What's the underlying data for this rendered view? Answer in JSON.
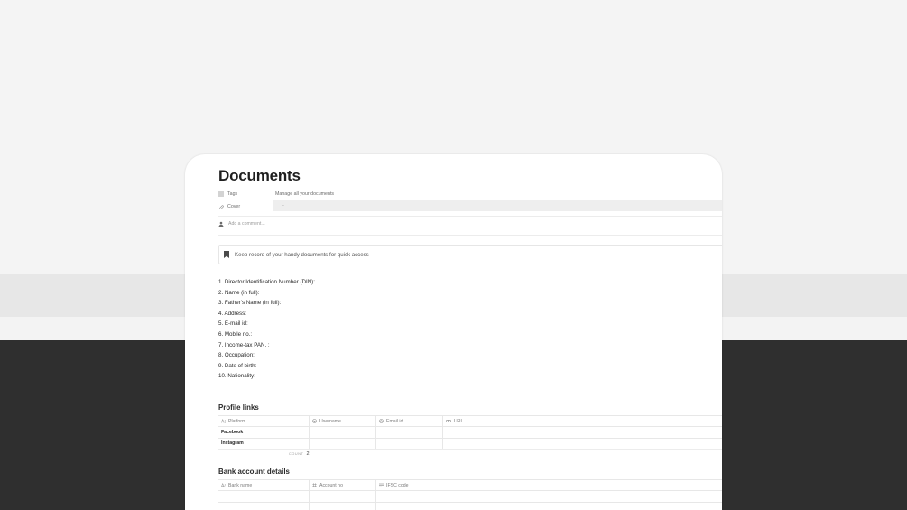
{
  "page": {
    "title": "Documents",
    "properties": [
      {
        "icon": "list-icon",
        "name": "Tags",
        "value": "Manage all your documents"
      },
      {
        "icon": "paperclip-icon",
        "name": "Cover",
        "value": "-"
      }
    ],
    "comment_placeholder": "Add a comment...",
    "callout": "Keep record of your handy documents for quick access"
  },
  "details_list": [
    "1. Director Identification Number (DIN):",
    "2. Name (in full):",
    "3. Father's Name (in full):",
    "4. Address:",
    "5. E-mail id:",
    "6. Mobile no.:",
    "7. Income-tax PAN. :",
    "8. Occupation:",
    "9. Date of birth:",
    "10. Nationality:"
  ],
  "profile_links": {
    "heading": "Profile links",
    "columns": [
      "Platform",
      "Username",
      "Email id",
      "URL"
    ],
    "rows": [
      [
        "Facebook",
        "",
        "",
        ""
      ],
      [
        "Instagram",
        "",
        "",
        ""
      ]
    ],
    "count_label": "COUNT",
    "count_value": "2"
  },
  "bank_details": {
    "heading": "Bank account details",
    "columns": [
      "Bank name",
      "Account no",
      "IFSC code"
    ]
  },
  "colors": {
    "background": "#f4f4f4",
    "band": "#e7e7e7",
    "dark_footer": "#2f2f2f",
    "card": "#ffffff",
    "text": "#37352f"
  }
}
